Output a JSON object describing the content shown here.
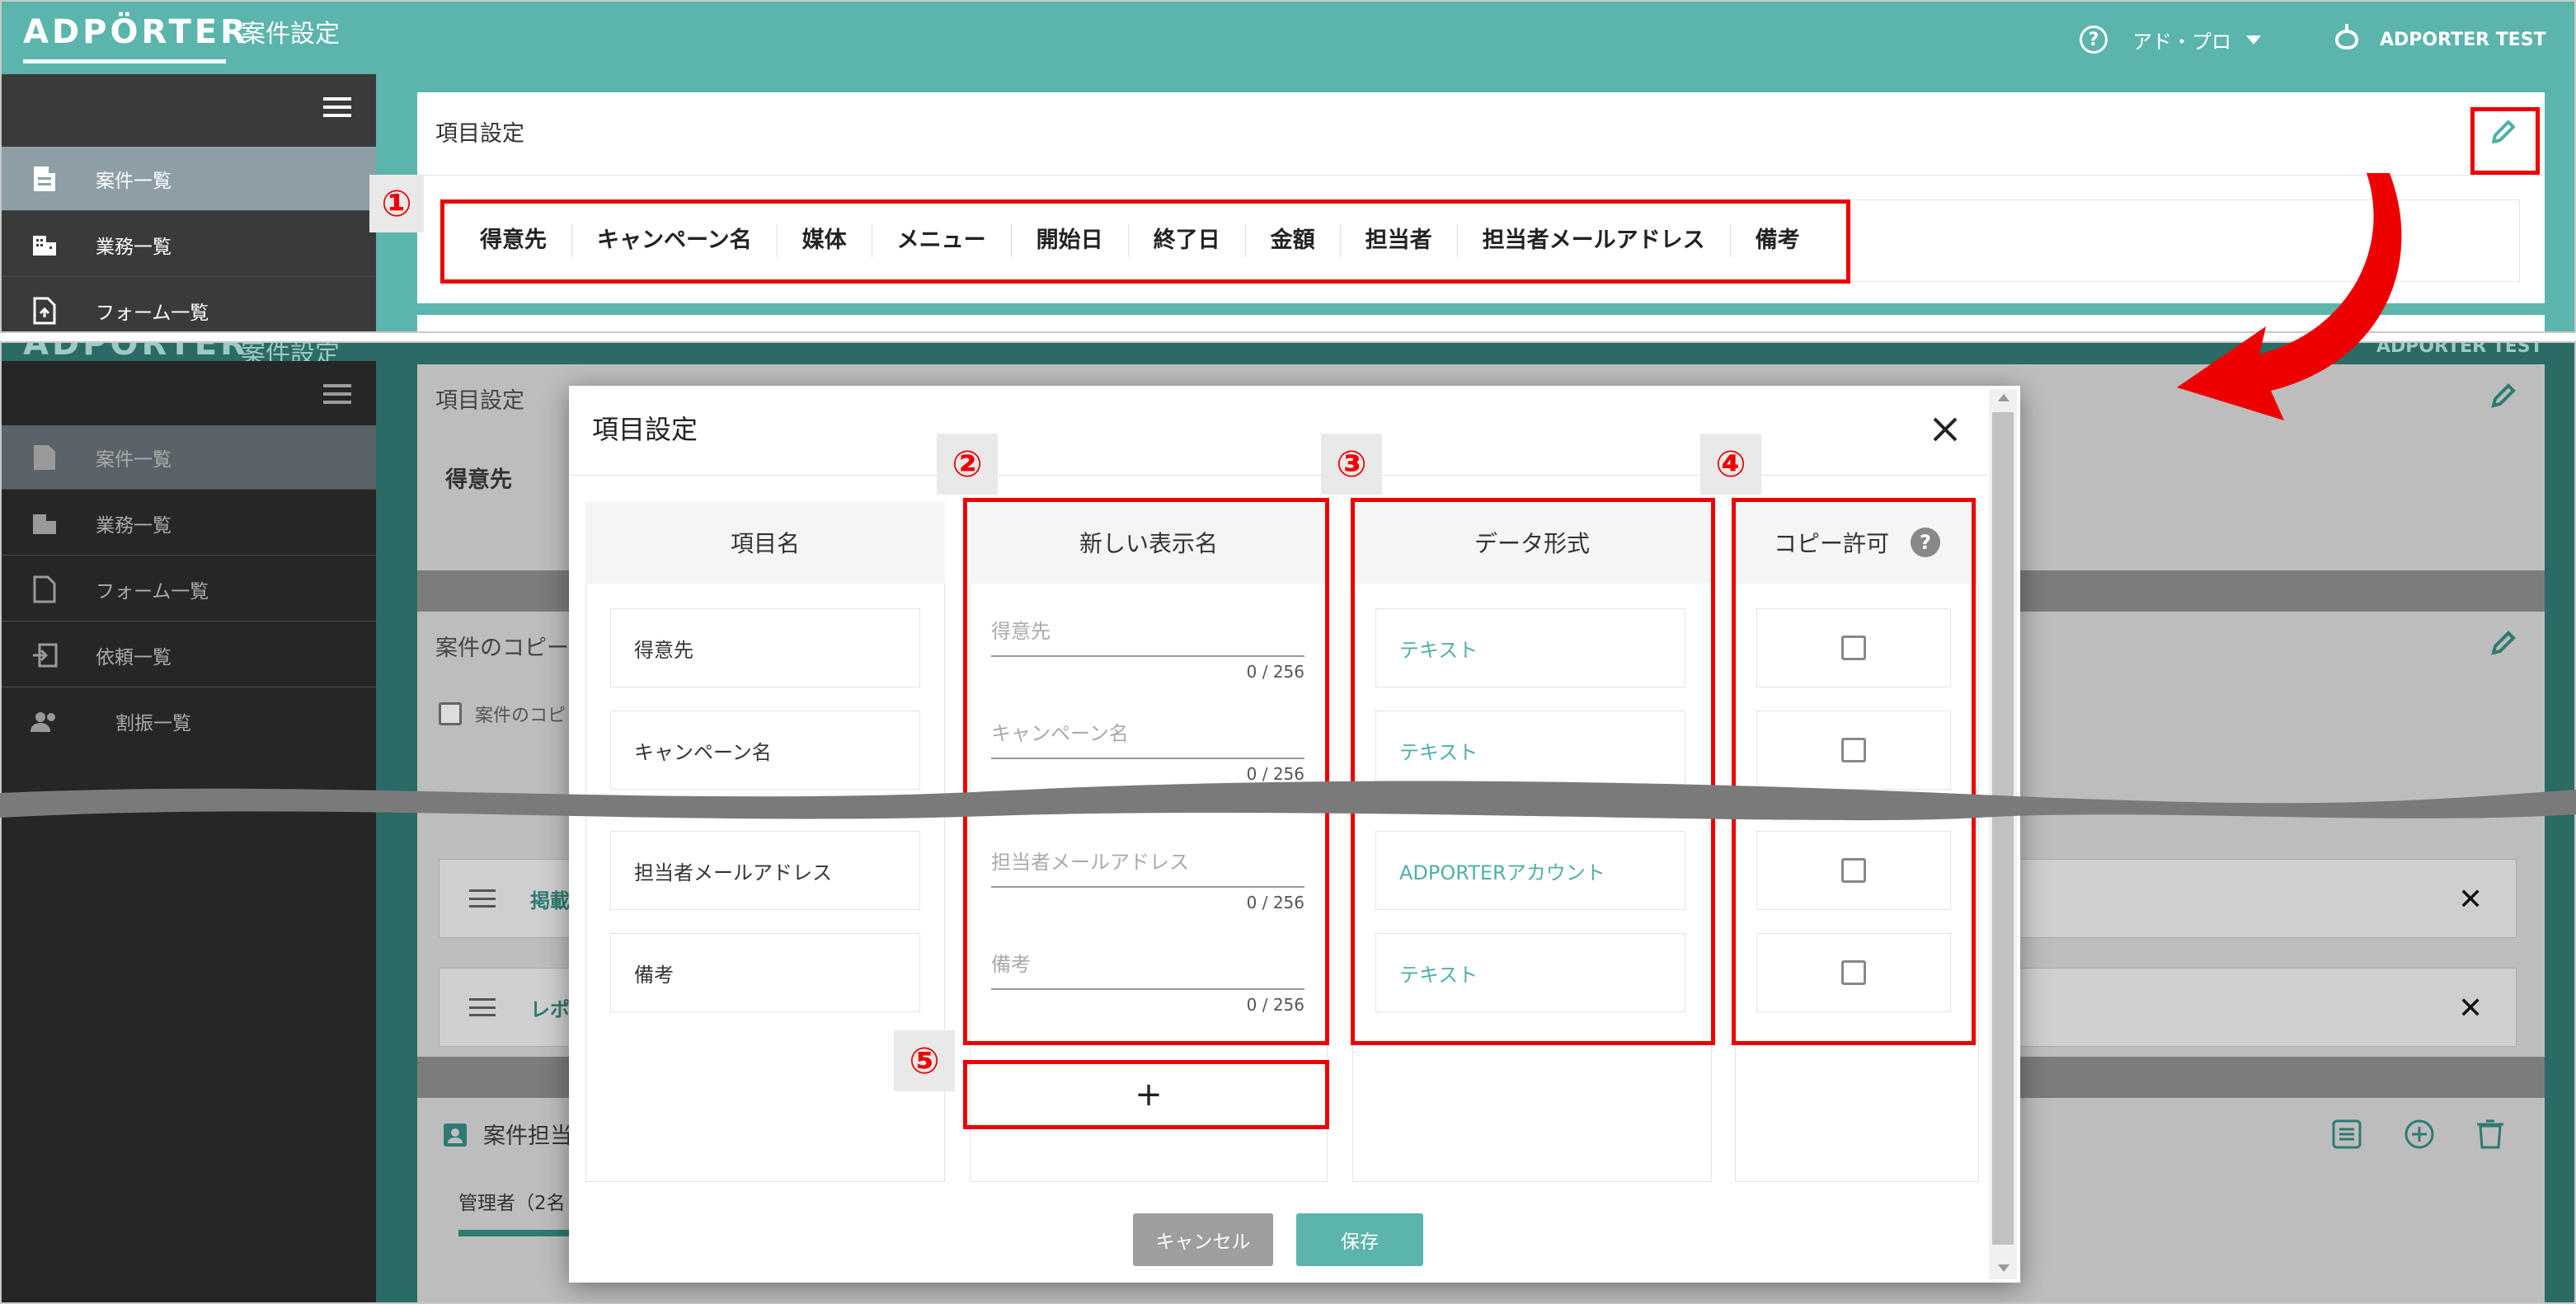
{
  "header": {
    "logo_text": "ADPÖRTER",
    "title": "案件設定",
    "help_icon": "?",
    "org_name": "アド・プロ",
    "user_name": "ADPORTER TEST"
  },
  "sidebar": {
    "items": [
      {
        "label": "案件一覧",
        "icon": "document-icon"
      },
      {
        "label": "業務一覧",
        "icon": "building-icon"
      },
      {
        "label": "フォーム一覧",
        "icon": "form-icon"
      },
      {
        "label": "依頼一覧",
        "icon": "request-icon"
      },
      {
        "label": "割振一覧",
        "icon": "people-icon"
      }
    ]
  },
  "item_settings_card": {
    "title": "項目設定",
    "columns": [
      "得意先",
      "キャンペーン名",
      "媒体",
      "メニュー",
      "開始日",
      "終了日",
      "金額",
      "担当者",
      "担当者メールアドレス",
      "備考"
    ],
    "first_column": "得意先"
  },
  "copy_card": {
    "title": "案件のコピー",
    "checkbox_label": "案件のコピ",
    "rows": [
      {
        "label": "掲載"
      },
      {
        "label": "レポ"
      }
    ]
  },
  "person_card": {
    "title": "案件担当",
    "admin_label": "管理者（2名"
  },
  "markers": {
    "m1": "①",
    "m2": "②",
    "m3": "③",
    "m4": "④",
    "m5": "⑤"
  },
  "modal": {
    "title": "項目設定",
    "columns": {
      "name": "項目名",
      "new_name": "新しい表示名",
      "format": "データ形式",
      "copy": "コピー許可"
    },
    "help_icon": "?",
    "rows": [
      {
        "name": "得意先",
        "placeholder": "得意先",
        "count": "0 / 256",
        "format": "テキスト"
      },
      {
        "name": "キャンペーン名",
        "placeholder": "キャンペーン名",
        "count": "0 / 256",
        "format": "テキスト"
      },
      {
        "name": "担当者メールアドレス",
        "placeholder": "担当者メールアドレス",
        "count": "0 / 256",
        "format": "ADPORTERアカウント"
      },
      {
        "name": "備考",
        "placeholder": "備考",
        "count": "0 / 256",
        "format": "テキスト"
      }
    ],
    "add_button": "+",
    "cancel_button": "キャンセル",
    "save_button": "保存"
  },
  "colors": {
    "header_teal": "#5bb5ac",
    "sidebar_dark": "#3a3a3a",
    "sidebar_active": "#8d9ea6",
    "accent_teal": "#4fb0a6",
    "highlight_red": "#e00000"
  }
}
